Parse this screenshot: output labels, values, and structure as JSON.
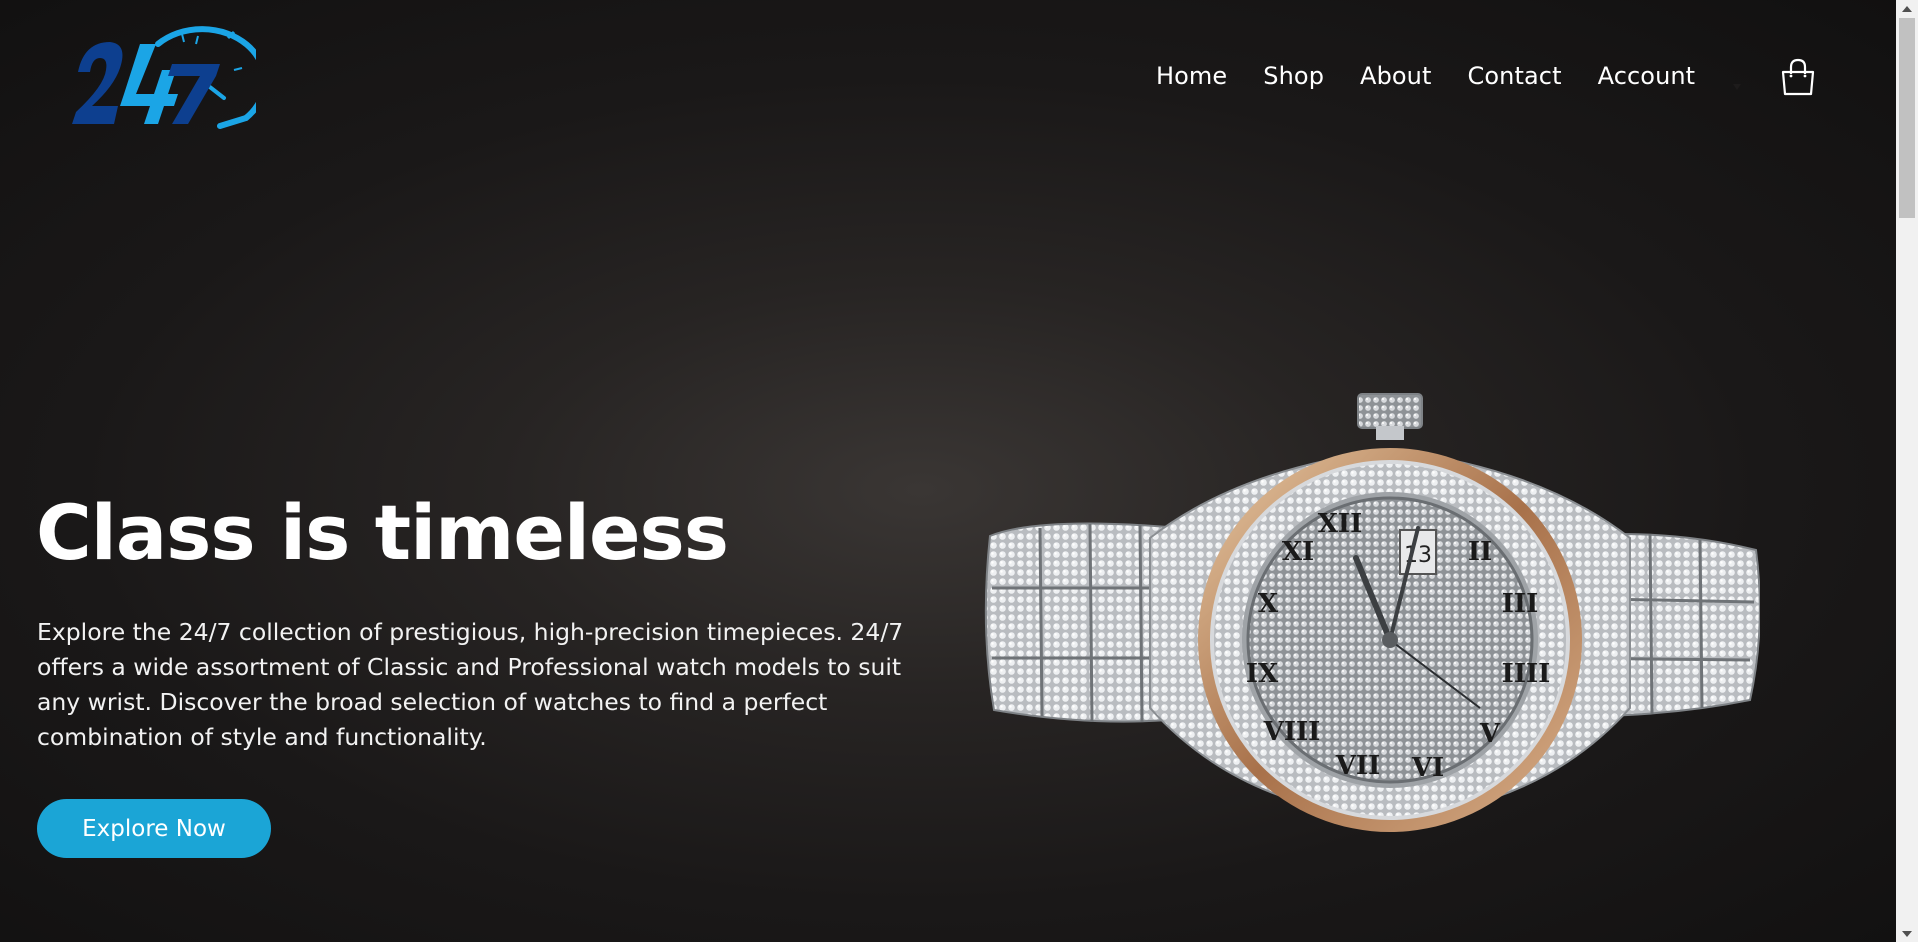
{
  "brand": {
    "logo_text": "24/7",
    "colors": {
      "dark_blue": "#0d3f8f",
      "light_blue": "#1ba5e6"
    }
  },
  "nav": {
    "items": [
      {
        "label": "Home"
      },
      {
        "label": "Shop"
      },
      {
        "label": "About"
      },
      {
        "label": "Contact"
      },
      {
        "label": "Account"
      }
    ],
    "account_dropdown_icon": "caret-down",
    "cart_icon": "shopping-bag"
  },
  "hero": {
    "title": "Class is timeless",
    "description": "Explore the 24/7 collection of prestigious, high-precision timepieces. 24/7 offers a wide assortment of Classic and Professional watch models to suit any wrist. Discover the broad selection of watches to find a perfect combination of style and functionality.",
    "cta_label": "Explore Now",
    "cta_color": "#1ba5d6",
    "image_icon": "diamond-watch"
  }
}
